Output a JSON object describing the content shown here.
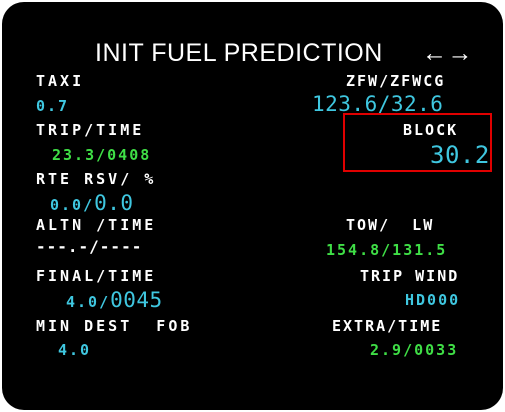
{
  "title": "INIT FUEL PREDICTION",
  "title_arrows": "←→",
  "left": {
    "taxi_label": "TAXI",
    "taxi_value": "0.7",
    "trip_time_label": "TRIP/TIME",
    "trip_time_value": "23.3/0408",
    "rte_rsv_label": "RTE RSV/ %",
    "rte_rsv_value_small": "0.0/",
    "rte_rsv_value_large": "0.0",
    "altn_time_label": "ALTN /TIME",
    "altn_time_value": "---.-/----",
    "final_time_label": "FINAL/TIME",
    "final_time_value_small": "4.0/",
    "final_time_value_large": "0045",
    "min_dest_fob_label": "MIN DEST  FOB",
    "min_dest_fob_value": "4.0"
  },
  "right": {
    "zfw_label": "ZFW/ZFWCG",
    "zfw_value": "123.6/32.6",
    "block_label": "BLOCK",
    "block_value": "30.2",
    "tow_lw_label": "TOW/  LW",
    "tow_lw_value": "154.8/131.5",
    "trip_wind_label": "TRIP WIND",
    "trip_wind_value": "HD000",
    "extra_time_label": "EXTRA/TIME",
    "extra_time_value": "2.9/0033"
  },
  "colors": {
    "background": "#000000",
    "label": "#ffffff",
    "cyan": "#3fc7e0",
    "green": "#3fde46",
    "highlight_box": "#e00000"
  }
}
